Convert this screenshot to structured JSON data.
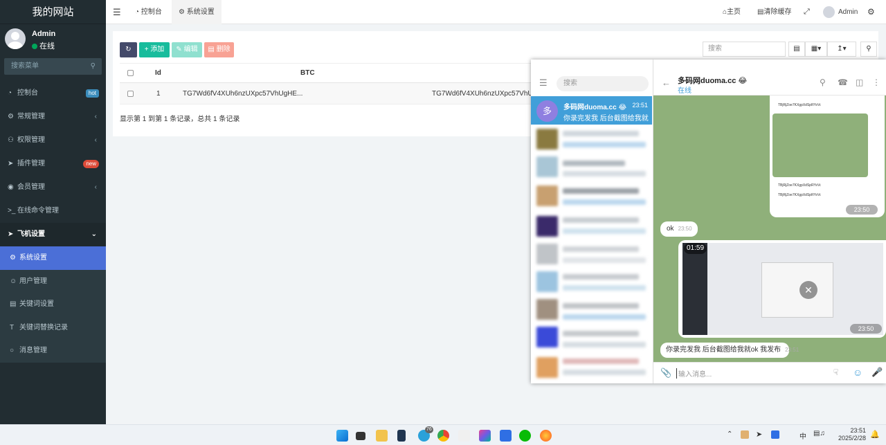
{
  "sidebar": {
    "logo": "我的网站",
    "user_name": "Admin",
    "user_status": "在线",
    "search_placeholder": "搜索菜单",
    "items": [
      {
        "label": "控制台",
        "icon": "dashboard-icon",
        "badge": "hot",
        "badge_color": "#3c8dbc"
      },
      {
        "label": "常规管理",
        "icon": "cogs-icon"
      },
      {
        "label": "权限管理",
        "icon": "users-icon"
      },
      {
        "label": "插件管理",
        "icon": "rocket-icon",
        "badge": "new",
        "badge_color": "#dd4b39"
      },
      {
        "label": "会员管理",
        "icon": "user-circle-icon"
      },
      {
        "label": "在线命令管理",
        "icon": "terminal-icon"
      },
      {
        "label": "飞机设置",
        "icon": "telegram-icon"
      }
    ],
    "sub_items": [
      {
        "label": "系统设置",
        "icon": "gear-icon"
      },
      {
        "label": "用户管理",
        "icon": "user-icon"
      },
      {
        "label": "关键词设置",
        "icon": "file-icon"
      },
      {
        "label": "关键词替换记录",
        "icon": "text-icon"
      },
      {
        "label": "消息管理",
        "icon": "comment-icon"
      }
    ]
  },
  "topbar": {
    "tab_dashboard": "控制台",
    "tab_settings": "系统设置",
    "home": "主页",
    "clear_cache": "清除缓存",
    "admin": "Admin"
  },
  "toolbar": {
    "add": "添加",
    "edit": "编辑",
    "delete": "删除",
    "search_placeholder": "搜索"
  },
  "table": {
    "headers": [
      "Id",
      "BTC"
    ],
    "rows": [
      {
        "id": "1",
        "btc": "TG7Wd6fV4XUh6nzUXpc57VhUgHE...",
        "col3": "TG7Wd6fV4XUh6nzUXpc57VhUgH"
      }
    ],
    "footer": "显示第 1 到第 1 条记录，总共 1 条记录"
  },
  "telegram": {
    "search_placeholder": "搜索",
    "chat_name": "多码网duoma.cc 😂",
    "chat_avatar": "多",
    "chat_time": "23:51",
    "chat_preview": "你录完发我 后台截图给我就ok 我发布",
    "header_title": "多码网duoma.cc 😂",
    "header_status": "在线",
    "addr1": "TBjRjZoe7KXgpXdSpRYvVo53Ccazh54MMM",
    "addr2": "TBjRjZoe7KXgpXdSpRYvVo53Ccazh54MMM",
    "addr3": "TBjRjZoe7KXgpXdSpRYvVo53Ccazh54MMM",
    "img_time1": "23:50",
    "msg_ok": "ok",
    "msg_ok_time": "23:50",
    "video_duration": "01:59",
    "video_time": "23:50",
    "last_msg": "你录完发我 后台截图给我就ok 我发布",
    "last_msg_time": "23:51",
    "input_placeholder": "输入消息..."
  },
  "taskbar": {
    "ime": "中",
    "time": "23:51",
    "date": "2025/2/28",
    "tg_badge": "76"
  }
}
